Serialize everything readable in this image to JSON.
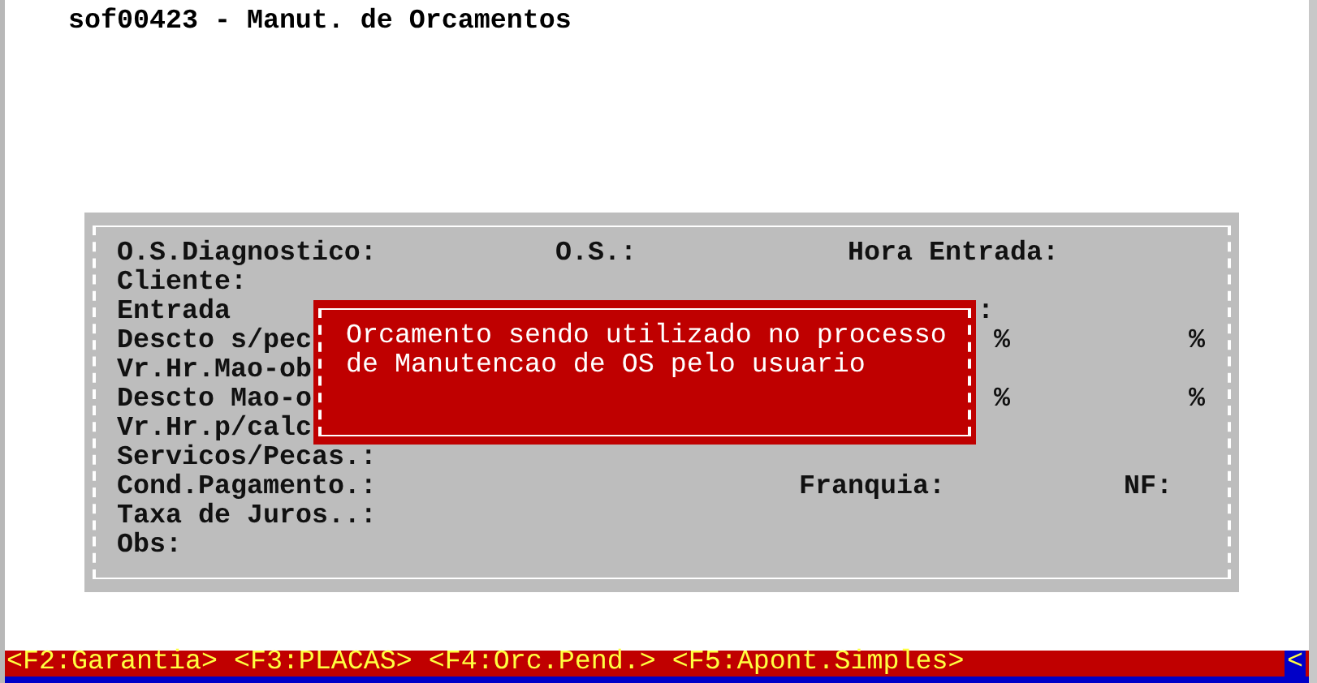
{
  "window": {
    "title": "sof00423 - Manut. de Orcamentos"
  },
  "form": {
    "rows": [
      {
        "label": "O.S.Diagnostico:",
        "extras": [
          {
            "kind": "os",
            "text": "O.S.:"
          },
          {
            "kind": "hora",
            "text": "Hora Entrada:"
          }
        ]
      },
      {
        "label": "Cliente:",
        "extras": []
      },
      {
        "label": "Entrada",
        "extras": [
          {
            "kind": "colon",
            "text": ":"
          }
        ]
      },
      {
        "label": "Descto s/pec",
        "extras": [
          {
            "kind": "pct_a",
            "text": "%"
          },
          {
            "kind": "pct_b",
            "text": "%"
          }
        ]
      },
      {
        "label": "Vr.Hr.Mao-ob",
        "extras": []
      },
      {
        "label": "Descto Mao-o",
        "extras": [
          {
            "kind": "pct_a",
            "text": "%"
          },
          {
            "kind": "pct_b",
            "text": "%"
          }
        ]
      },
      {
        "label": "Vr.Hr.p/calc",
        "extras": []
      },
      {
        "label": "Servicos/Pecas.:",
        "extras": []
      },
      {
        "label": "Cond.Pagamento.:",
        "extras": [
          {
            "kind": "franquia",
            "text": "Franquia:"
          },
          {
            "kind": "nf",
            "text": "NF:"
          }
        ]
      },
      {
        "label": "Taxa de Juros..:",
        "extras": []
      },
      {
        "label": "Obs:",
        "extras": []
      }
    ]
  },
  "popup": {
    "lines": [
      "Orcamento sendo utilizado no processo",
      "de Manutencao de OS pelo usuario"
    ]
  },
  "function_keys": [
    "<F2:Garantia>",
    "<F3:PLACAS>",
    "<F4:Orc.Pend.>",
    "<F5:Apont.Simples>"
  ],
  "scroll_indicator": "<"
}
